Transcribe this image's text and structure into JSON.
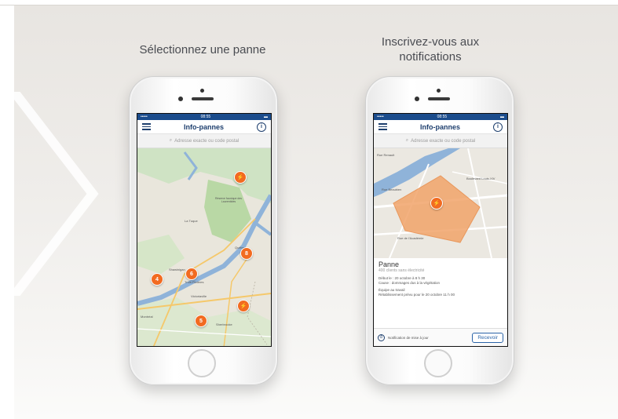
{
  "captions": {
    "left": "Sélectionnez une panne",
    "right_line1": "Inscrivez-vous aux",
    "right_line2": "notifications"
  },
  "app": {
    "time": "08:55",
    "carrier": "••••• ",
    "title": "Info-pannes",
    "search_placeholder": "Adresse exacte ou code postal",
    "accent_color": "#1e3f6e",
    "marker_color": "#f26b21"
  },
  "left_map": {
    "markers": [
      "⚡",
      "8",
      "6",
      "4",
      "⚡",
      "5"
    ],
    "labels": [
      "La Tuque",
      "Québec",
      "Shawinigan",
      "Trois-Rivières",
      "Victoriaville",
      "Montréal",
      "Sherbrooke",
      "Réserve faunique des Laurentides"
    ]
  },
  "right_map": {
    "marker": "⚡",
    "streets": [
      "Rue Renault",
      "Rue Beaubien",
      "Rue de l'Académie",
      "Boulevard Louis-XIV"
    ],
    "overlay_color": "#f2a46a"
  },
  "panel": {
    "title": "Panne",
    "subtitle": "400 clients sans électricité",
    "start": "Début le : 20 octobre à 8 h 30",
    "cause": "Cause : dommages dus à la végétation",
    "crew": "Équipe au travail",
    "restore": "Rétablissement prévu pour le 20 octobre 11 h 00",
    "notif_label": "Notification de mise à jour",
    "button": "Recevoir"
  }
}
